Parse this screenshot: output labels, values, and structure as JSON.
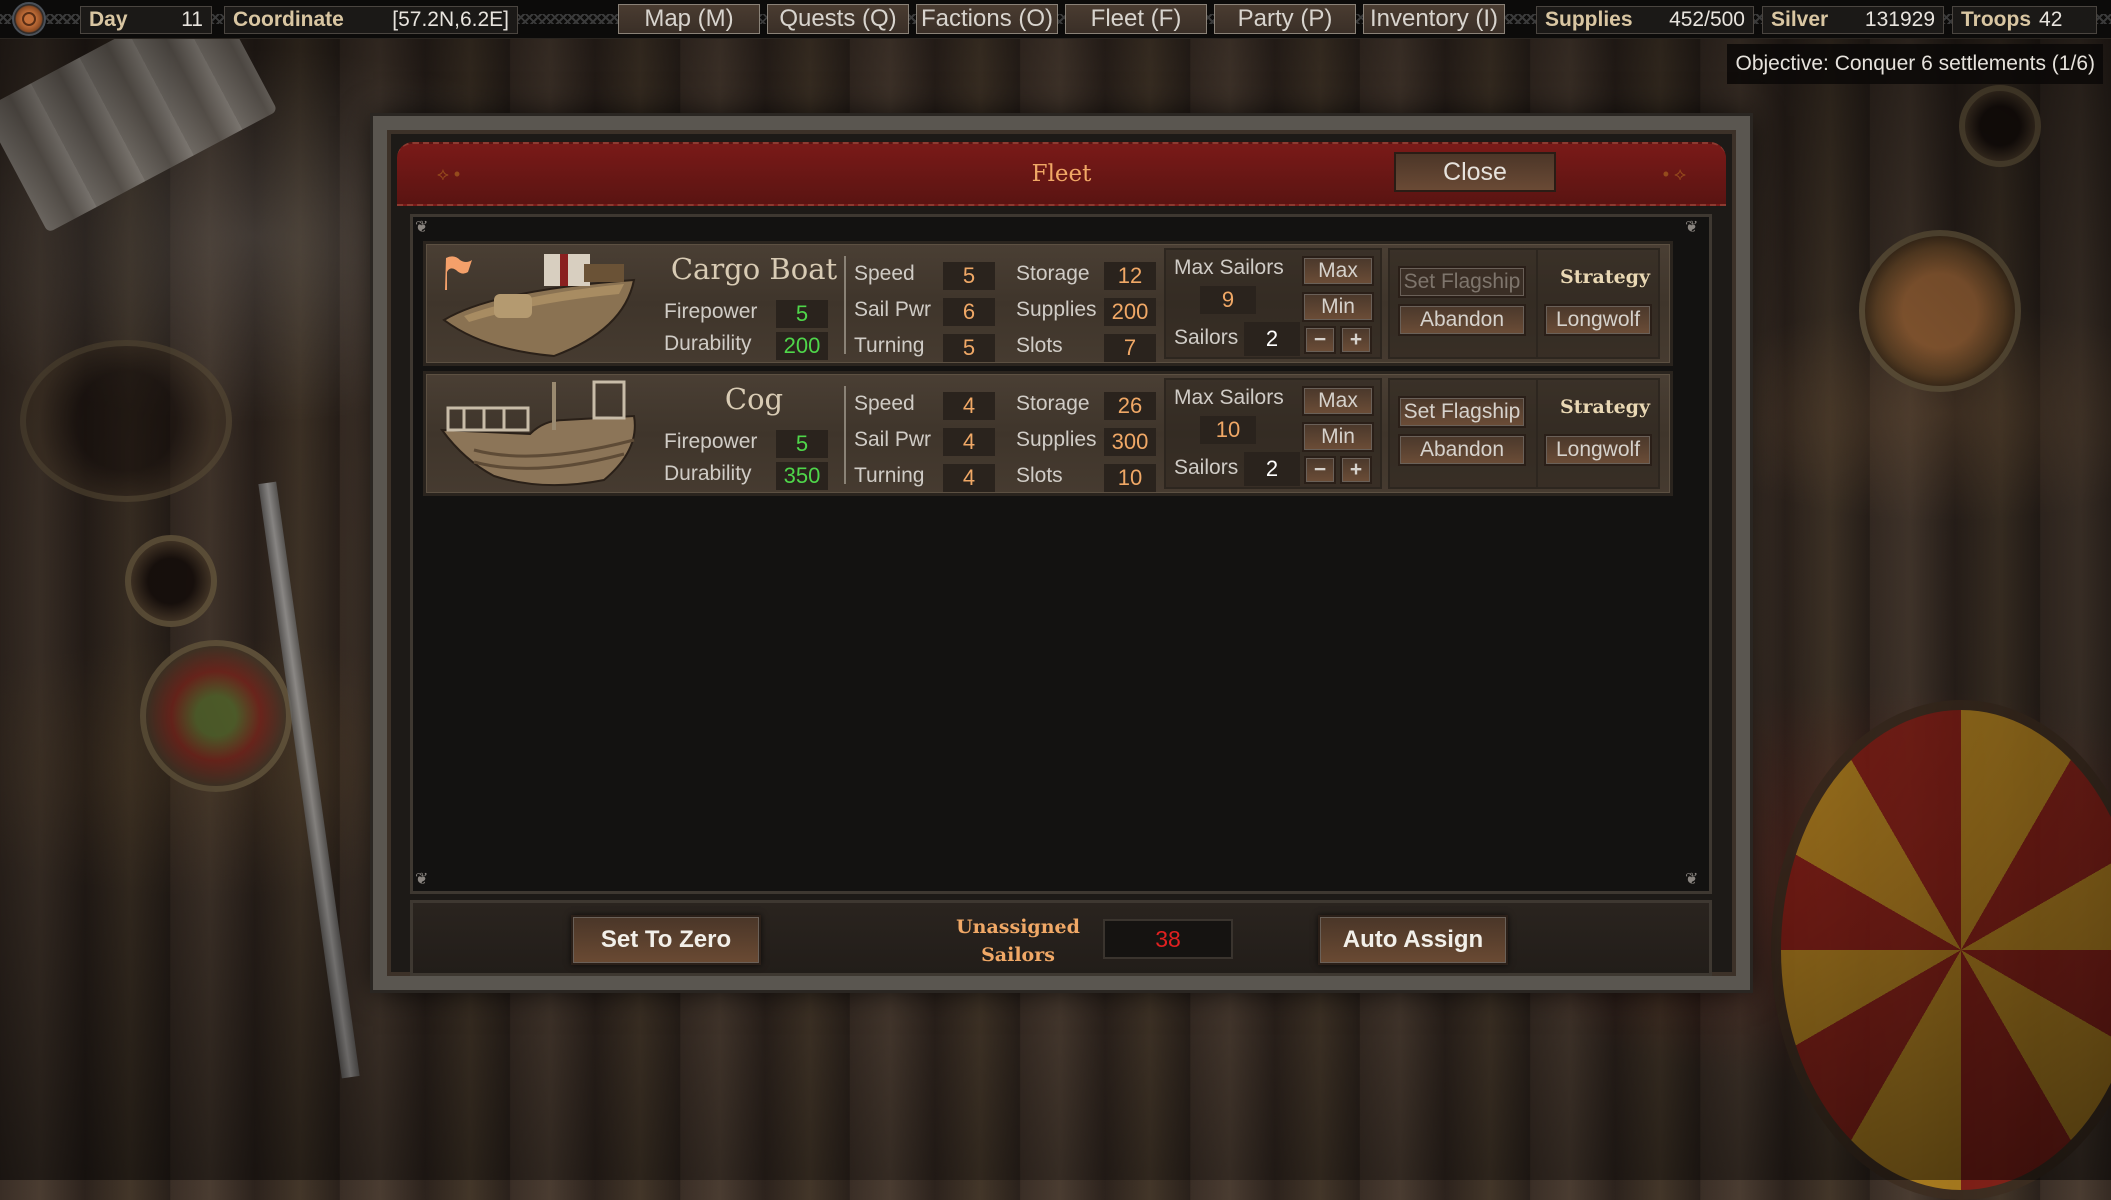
{
  "topbar": {
    "day_label": "Day",
    "day_value": "11",
    "coordinate_label": "Coordinate",
    "coordinate_value": "[57.2N,6.2E]",
    "nav": [
      {
        "label": "Map (M)"
      },
      {
        "label": "Quests (Q)"
      },
      {
        "label": "Factions (O)"
      },
      {
        "label": "Fleet (F)"
      },
      {
        "label": "Party (P)"
      },
      {
        "label": "Inventory (I)"
      }
    ],
    "supplies_label": "Supplies",
    "supplies_value": "452/500",
    "silver_label": "Silver",
    "silver_value": "131929",
    "troops_label": "Troops",
    "troops_value": "42"
  },
  "objective": "Objective: Conquer 6 settlements (1/6)",
  "dialog": {
    "title": "Fleet",
    "close_label": "Close",
    "ships": [
      {
        "name": "Cargo Boat",
        "is_flagship": true,
        "firepower_label": "Firepower",
        "firepower": "5",
        "durability_label": "Durability",
        "durability": "200",
        "speed_label": "Speed",
        "speed": "5",
        "sail_pwr_label": "Sail Pwr",
        "sail_pwr": "6",
        "turning_label": "Turning",
        "turning": "5",
        "storage_label": "Storage",
        "storage": "12",
        "supplies_label": "Supplies",
        "supplies": "200",
        "slots_label": "Slots",
        "slots": "7",
        "max_sailors_label": "Max Sailors",
        "max_sailors": "9",
        "sailors_label": "Sailors",
        "sailors": "2",
        "max_label": "Max",
        "min_label": "Min",
        "minus_label": "−",
        "plus_label": "+",
        "set_flagship_label": "Set Flagship",
        "set_flagship_enabled": false,
        "abandon_label": "Abandon",
        "strategy_label": "Strategy",
        "strategy_value": "Longwolf"
      },
      {
        "name": "Cog",
        "is_flagship": false,
        "firepower_label": "Firepower",
        "firepower": "5",
        "durability_label": "Durability",
        "durability": "350",
        "speed_label": "Speed",
        "speed": "4",
        "sail_pwr_label": "Sail Pwr",
        "sail_pwr": "4",
        "turning_label": "Turning",
        "turning": "4",
        "storage_label": "Storage",
        "storage": "26",
        "supplies_label": "Supplies",
        "supplies": "300",
        "slots_label": "Slots",
        "slots": "10",
        "max_sailors_label": "Max Sailors",
        "max_sailors": "10",
        "sailors_label": "Sailors",
        "sailors": "2",
        "max_label": "Max",
        "min_label": "Min",
        "minus_label": "−",
        "plus_label": "+",
        "set_flagship_label": "Set Flagship",
        "set_flagship_enabled": true,
        "abandon_label": "Abandon",
        "strategy_label": "Strategy",
        "strategy_value": "Longwolf"
      }
    ],
    "set_to_zero_label": "Set To Zero",
    "unassigned_label_line1": "Unassigned",
    "unassigned_label_line2": "Sailors",
    "unassigned_value": "38",
    "auto_assign_label": "Auto Assign"
  },
  "colors": {
    "stat_orange": "#f0a866",
    "stat_green": "#4fd64a",
    "unassigned_red": "#e02020",
    "title_bar_red": "#6a1614"
  }
}
